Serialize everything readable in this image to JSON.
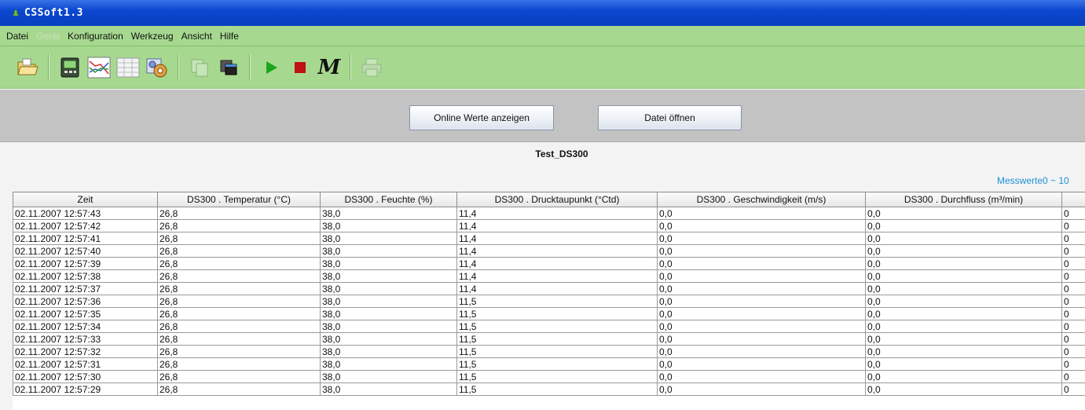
{
  "window": {
    "title": "CSSoft1.3"
  },
  "menu": [
    {
      "label": "Datei",
      "enabled": true
    },
    {
      "label": "Gerät",
      "enabled": false
    },
    {
      "label": "Konfiguration",
      "enabled": true
    },
    {
      "label": "Werkzeug",
      "enabled": true
    },
    {
      "label": "Ansicht",
      "enabled": true
    },
    {
      "label": "Hilfe",
      "enabled": true
    }
  ],
  "toolbar": {
    "icons": [
      "open-folder-icon",
      "device-icon",
      "chart-icon",
      "table-icon",
      "settings-icon",
      "copy-icon",
      "window-icon",
      "play-icon",
      "stop-icon",
      "m-icon",
      "print-icon"
    ],
    "m_glyph": "M"
  },
  "buttons": {
    "online": "Online Werte anzeigen",
    "open_file": "Datei öffnen"
  },
  "data": {
    "title": "Test_DS300",
    "range": "Messwerte0 ~ 10",
    "columns": [
      "Zeit",
      "DS300 . Temperatur (°C)",
      "DS300 . Feuchte (%)",
      "DS300 . Drucktaupunkt (°Ctd)",
      "DS300 . Geschwindigkeit (m/s)",
      "DS300 . Durchfluss (m³/min)",
      ""
    ],
    "rows": [
      [
        "02.11.2007 12:57:43",
        "26,8",
        "38,0",
        "11,4",
        "0,0",
        "0,0",
        "0"
      ],
      [
        "02.11.2007 12:57:42",
        "26,8",
        "38,0",
        "11,4",
        "0,0",
        "0,0",
        "0"
      ],
      [
        "02.11.2007 12:57:41",
        "26,8",
        "38,0",
        "11,4",
        "0,0",
        "0,0",
        "0"
      ],
      [
        "02.11.2007 12:57:40",
        "26,8",
        "38,0",
        "11,4",
        "0,0",
        "0,0",
        "0"
      ],
      [
        "02.11.2007 12:57:39",
        "26,8",
        "38,0",
        "11,4",
        "0,0",
        "0,0",
        "0"
      ],
      [
        "02.11.2007 12:57:38",
        "26,8",
        "38,0",
        "11,4",
        "0,0",
        "0,0",
        "0"
      ],
      [
        "02.11.2007 12:57:37",
        "26,8",
        "38,0",
        "11,4",
        "0,0",
        "0,0",
        "0"
      ],
      [
        "02.11.2007 12:57:36",
        "26,8",
        "38,0",
        "11,5",
        "0,0",
        "0,0",
        "0"
      ],
      [
        "02.11.2007 12:57:35",
        "26,8",
        "38,0",
        "11,5",
        "0,0",
        "0,0",
        "0"
      ],
      [
        "02.11.2007 12:57:34",
        "26,8",
        "38,0",
        "11,5",
        "0,0",
        "0,0",
        "0"
      ],
      [
        "02.11.2007 12:57:33",
        "26,8",
        "38,0",
        "11,5",
        "0,0",
        "0,0",
        "0"
      ],
      [
        "02.11.2007 12:57:32",
        "26,8",
        "38,0",
        "11,5",
        "0,0",
        "0,0",
        "0"
      ],
      [
        "02.11.2007 12:57:31",
        "26,8",
        "38,0",
        "11,5",
        "0,0",
        "0,0",
        "0"
      ],
      [
        "02.11.2007 12:57:30",
        "26,8",
        "38,0",
        "11,5",
        "0,0",
        "0,0",
        "0"
      ],
      [
        "02.11.2007 12:57:29",
        "26,8",
        "38,0",
        "11,5",
        "0,0",
        "0,0",
        "0"
      ]
    ]
  },
  "colors": {
    "titlebar": "#0b47d0",
    "menubar": "#a6d98f",
    "link": "#1f8fd6"
  }
}
